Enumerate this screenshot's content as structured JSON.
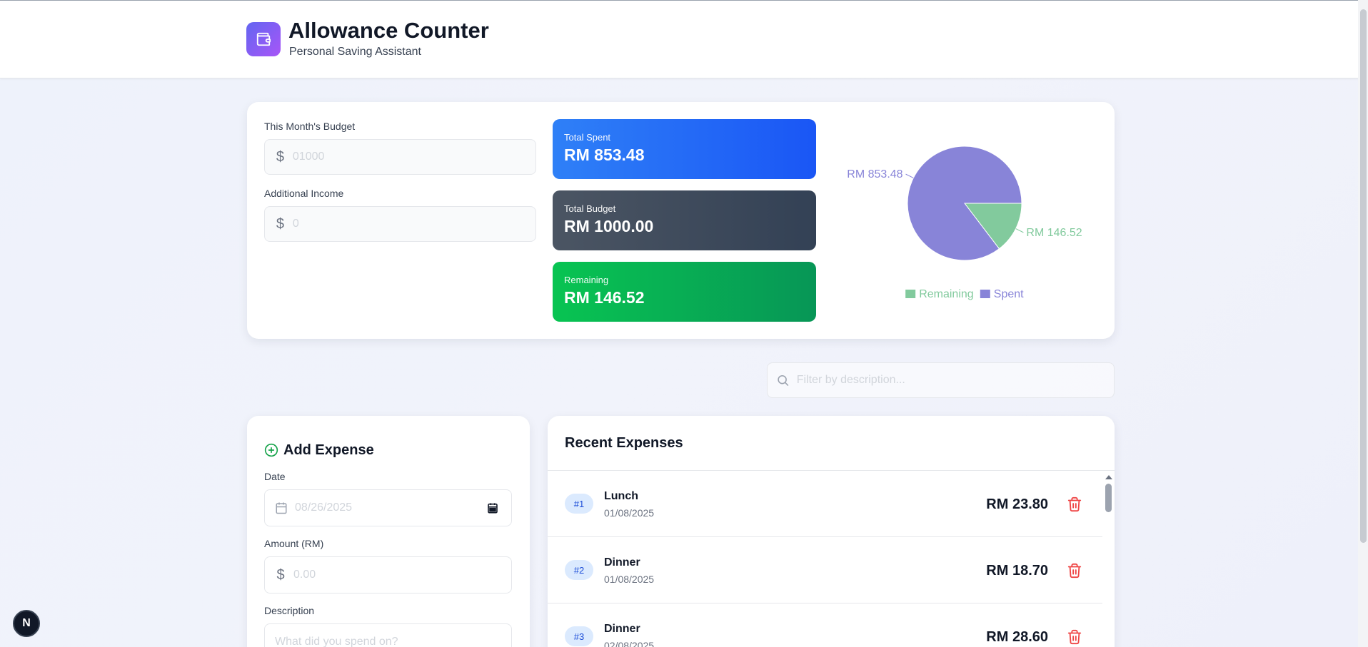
{
  "header": {
    "title": "Allowance Counter",
    "subtitle": "Personal Saving Assistant",
    "logo_icon": "wallet-icon"
  },
  "budget": {
    "monthly_label": "This Month's Budget",
    "monthly_placeholder": "01000",
    "income_label": "Additional Income",
    "income_placeholder": "0"
  },
  "stats": {
    "spent_label": "Total Spent",
    "spent_value": "RM 853.48",
    "budget_label": "Total Budget",
    "budget_value": "RM 1000.00",
    "remaining_label": "Remaining",
    "remaining_value": "RM 146.52"
  },
  "chart_data": {
    "type": "pie",
    "slices": [
      {
        "name": "Remaining",
        "value": 146.52,
        "label": "RM 146.52",
        "color": "#82ca9d"
      },
      {
        "name": "Spent",
        "value": 853.48,
        "label": "RM 853.48",
        "color": "#8884d8"
      }
    ],
    "legend": [
      "Remaining",
      "Spent"
    ],
    "legend_position": "bottom"
  },
  "search": {
    "placeholder": "Filter by description..."
  },
  "add_expense": {
    "title": "Add Expense",
    "date_label": "Date",
    "date_value": "08/26/2025",
    "amount_label": "Amount (RM)",
    "amount_placeholder": "0.00",
    "description_label": "Description",
    "description_placeholder": "What did you spend on?"
  },
  "recent": {
    "title": "Recent Expenses",
    "items": [
      {
        "index": "#1",
        "name": "Lunch",
        "date": "01/08/2025",
        "amount": "RM 23.80"
      },
      {
        "index": "#2",
        "name": "Dinner",
        "date": "01/08/2025",
        "amount": "RM 18.70"
      },
      {
        "index": "#3",
        "name": "Dinner",
        "date": "02/08/2025",
        "amount": "RM 28.60"
      }
    ]
  },
  "dev_badge": "N",
  "colors": {
    "spent": "#1a56f5",
    "budget": "#334155",
    "remaining": "#079656",
    "delete": "#ef4444",
    "add_icon": "#16a34a"
  }
}
